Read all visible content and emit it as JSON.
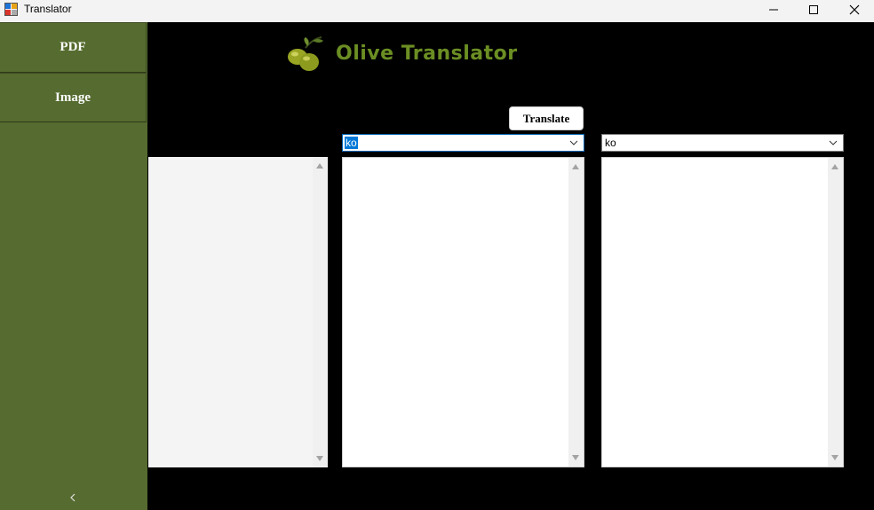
{
  "window": {
    "title": "Translator",
    "icon": "app-window-icon"
  },
  "titlebar_buttons": {
    "minimize_icon": "minimize-icon",
    "maximize_icon": "maximize-icon",
    "close_icon": "close-icon"
  },
  "sidebar": {
    "items": [
      {
        "label": "PDF"
      },
      {
        "label": "Image"
      }
    ],
    "collapse_icon": "chevron-left-icon",
    "color": "#556b2f"
  },
  "header": {
    "logo_icon": "olive-icon",
    "title": "Olive Translator",
    "title_color": "#6b8e23"
  },
  "toolbar": {
    "translate_label": "Translate"
  },
  "source_language": {
    "value": "ko"
  },
  "target_language": {
    "value": "ko"
  },
  "panels": {
    "left_text": "",
    "source_text": "",
    "target_text": ""
  }
}
